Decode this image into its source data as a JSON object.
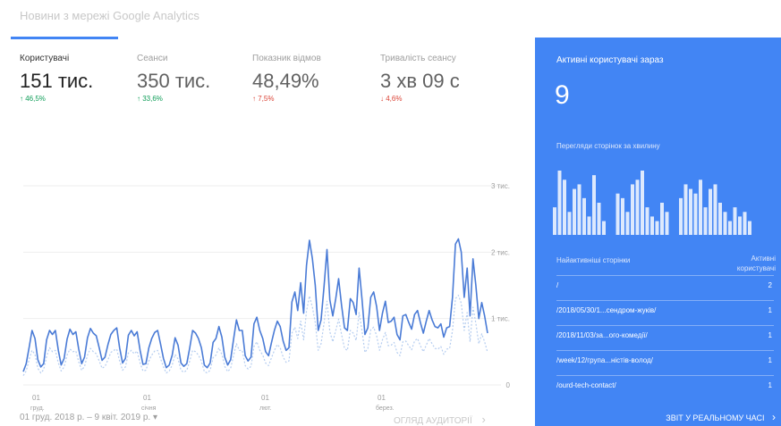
{
  "header": {
    "title": "Новини з мережі Google Analytics"
  },
  "metrics": [
    {
      "label": "Користувачі",
      "value": "151 тис.",
      "change": "↑ 46,5%",
      "trend": "up"
    },
    {
      "label": "Сеанси",
      "value": "350 тис.",
      "change": "↑ 33,6%",
      "trend": "up"
    },
    {
      "label": "Показник відмов",
      "value": "48,49%",
      "change": "↑ 7,5%",
      "trend": "down"
    },
    {
      "label": "Тривалість сеансу",
      "value": "3 хв 09 с",
      "change": "↓ 4,6%",
      "trend": "down"
    }
  ],
  "chart_data": {
    "type": "line",
    "y_ticks": [
      "0",
      "1 тис.",
      "2 тис.",
      "3 тис."
    ],
    "ylim": [
      0,
      3000
    ],
    "x_ticks": [
      {
        "day": "01",
        "month": "груд."
      },
      {
        "day": "01",
        "month": "січня"
      },
      {
        "day": "01",
        "month": "лют."
      },
      {
        "day": "01",
        "month": "берез."
      }
    ],
    "series": [
      {
        "name": "",
        "color": "#4a7bd6",
        "values": [
          200,
          320,
          560,
          820,
          700,
          380,
          270,
          320,
          680,
          820,
          760,
          820,
          520,
          300,
          400,
          690,
          840,
          760,
          800,
          540,
          320,
          420,
          710,
          850,
          780,
          740,
          560,
          370,
          420,
          610,
          760,
          820,
          860,
          560,
          330,
          400,
          750,
          820,
          740,
          800,
          520,
          310,
          320,
          560,
          700,
          790,
          820,
          620,
          400,
          260,
          300,
          450,
          710,
          600,
          330,
          280,
          320,
          560,
          820,
          780,
          700,
          560,
          300,
          260,
          330,
          640,
          700,
          880,
          720,
          420,
          300,
          380,
          680,
          980,
          820,
          820,
          440,
          360,
          420,
          920,
          1020,
          820,
          700,
          500,
          440,
          640,
          820,
          960,
          880,
          660,
          520,
          560,
          1250,
          1400,
          1120,
          1540,
          1080,
          1800,
          2180,
          1900,
          1500,
          820,
          980,
          1480,
          2040,
          1280,
          1040,
          1300,
          1600,
          1200,
          860,
          820,
          1300,
          1240,
          1060,
          1760,
          1300,
          760,
          860,
          1320,
          1400,
          1180,
          820,
          1080,
          1260,
          940,
          960,
          1020,
          760,
          680,
          1040,
          1060,
          940,
          840,
          1060,
          1120,
          940,
          780,
          960,
          1120,
          980,
          880,
          860,
          920,
          720,
          860,
          880,
          1320,
          2120,
          2200,
          2000,
          1320,
          1760,
          1040,
          1900,
          1500,
          1000,
          1240,
          1040,
          780
        ],
        "line_style": "solid"
      },
      {
        "name": "",
        "color": "#b5cdf0",
        "values": [
          140,
          210,
          380,
          520,
          460,
          250,
          180,
          230,
          430,
          560,
          500,
          520,
          330,
          210,
          270,
          450,
          540,
          500,
          510,
          350,
          220,
          280,
          450,
          550,
          500,
          470,
          360,
          250,
          280,
          380,
          490,
          520,
          540,
          360,
          220,
          270,
          480,
          520,
          470,
          510,
          330,
          210,
          220,
          360,
          450,
          510,
          520,
          400,
          270,
          180,
          210,
          300,
          460,
          390,
          220,
          190,
          220,
          360,
          520,
          500,
          450,
          360,
          200,
          180,
          220,
          410,
          450,
          560,
          460,
          280,
          200,
          250,
          440,
          620,
          520,
          520,
          290,
          240,
          280,
          580,
          650,
          520,
          450,
          330,
          290,
          410,
          520,
          610,
          560,
          420,
          340,
          360,
          780,
          870,
          700,
          960,
          680,
          1110,
          1340,
          1170,
          940,
          520,
          620,
          930,
          1260,
          800,
          650,
          820,
          990,
          760,
          550,
          520,
          820,
          780,
          670,
          1090,
          820,
          490,
          550,
          830,
          870,
          740,
          520,
          680,
          790,
          590,
          600,
          640,
          490,
          440,
          650,
          660,
          590,
          530,
          660,
          700,
          590,
          500,
          600,
          700,
          620,
          550,
          540,
          580,
          460,
          540,
          550,
          820,
          1300,
          1350,
          1230,
          820,
          1090,
          650,
          1170,
          930,
          620,
          770,
          650,
          490
        ],
        "line_style": "dashed"
      }
    ]
  },
  "footer": {
    "date_range": "01 груд. 2018 р. – 9 квіт. 2019 р. ▾",
    "overview_link": "ОГЛЯД АУДИТОРІЇ",
    "overview_arrow": "›"
  },
  "realtime": {
    "title": "Активні користувачі зараз",
    "count": "9",
    "pageviews_label": "Перегляди сторінок за хвилину",
    "minibars": [
      [
        6,
        14,
        12,
        5,
        10,
        11,
        8,
        4,
        13,
        7,
        3
      ],
      [
        9,
        8,
        5,
        11,
        12,
        14,
        6,
        4,
        3,
        7,
        5
      ],
      [
        8,
        11,
        10,
        9,
        12,
        6,
        10,
        11,
        7,
        5,
        3,
        6,
        4,
        5,
        3
      ]
    ],
    "col_pages": "Найактивніші сторінки",
    "col_users": "Активні користувачі",
    "rows": [
      {
        "page": "/",
        "count": "2"
      },
      {
        "page": "/2018/05/30/1...cендром-жуків/",
        "count": "1"
      },
      {
        "page": "/2018/11/03/за...ого-комедії/",
        "count": "1"
      },
      {
        "page": "/week/12/група...ністів-волод/",
        "count": "1"
      },
      {
        "page": "/ourd-tech-contact/",
        "count": "1"
      }
    ],
    "realtime_link": "ЗВІТ У РЕАЛЬНОМУ ЧАСІ",
    "realtime_arrow": "›"
  }
}
